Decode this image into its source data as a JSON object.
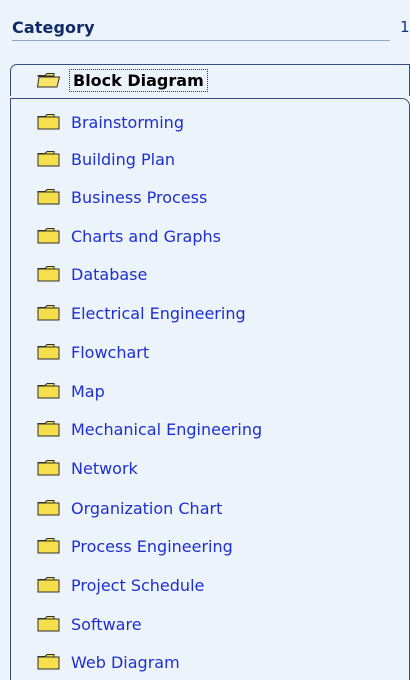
{
  "header": {
    "title": "Category",
    "edge_glyph": "1"
  },
  "items": [
    {
      "label": "Block Diagram",
      "selected": true
    },
    {
      "label": "Brainstorming"
    },
    {
      "label": "Building Plan"
    },
    {
      "label": "Business Process"
    },
    {
      "label": "Charts and Graphs"
    },
    {
      "label": "Database"
    },
    {
      "label": "Electrical Engineering"
    },
    {
      "label": "Flowchart"
    },
    {
      "label": "Map"
    },
    {
      "label": "Mechanical Engineering"
    },
    {
      "label": "Network"
    },
    {
      "label": "Organization Chart"
    },
    {
      "label": "Process Engineering"
    },
    {
      "label": "Project Schedule"
    },
    {
      "label": "Software"
    },
    {
      "label": "Web Diagram"
    }
  ],
  "icons": {
    "folder": "folder-icon",
    "open_folder": "open-folder-icon"
  },
  "colors": {
    "background": "#edf3fa",
    "link_text": "#1c2fd0",
    "header_text": "#0e2a66",
    "folder_fill": "#f5df4d",
    "folder_outline": "#2f2f2f"
  }
}
